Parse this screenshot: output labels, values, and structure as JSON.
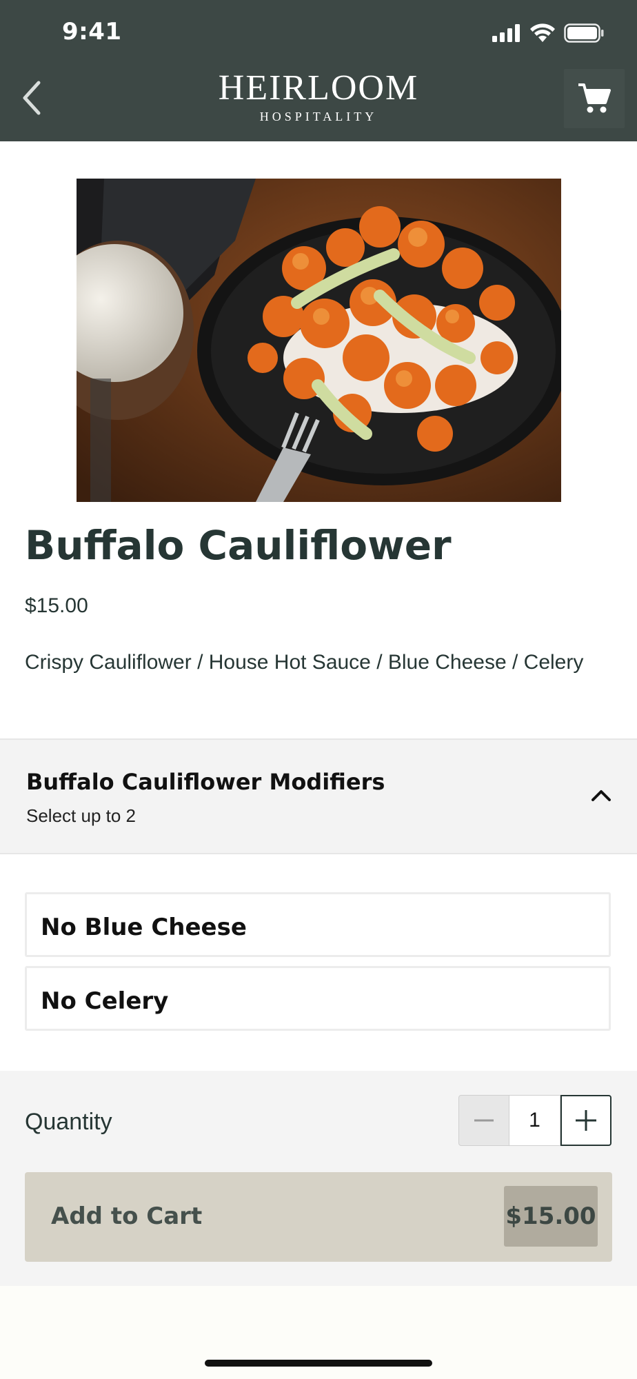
{
  "status_bar": {
    "time": "9:41"
  },
  "header": {
    "logo_main": "HEIRLOOM",
    "logo_sub": "HOSPITALITY",
    "back_icon": "chevron-left-icon",
    "cart_icon": "shopping-cart-icon"
  },
  "item": {
    "title": "Buffalo Cauliflower",
    "price": "$15.00",
    "description": "Crispy Cauliflower / House Hot Sauce / Blue Cheese / Celery"
  },
  "modifiers": {
    "title": "Buffalo Cauliflower Modifiers",
    "subtitle": "Select up to 2",
    "expanded": true,
    "options": [
      {
        "label": "No Blue Cheese"
      },
      {
        "label": "No Celery"
      }
    ]
  },
  "quantity": {
    "label": "Quantity",
    "value": "1"
  },
  "add_to_cart": {
    "label": "Add to Cart",
    "price": "$15.00"
  },
  "colors": {
    "header_bg": "#3d4845",
    "text_primary": "#263634",
    "button_bg": "#d6d2c6",
    "button_price_bg": "#b0ab9e"
  }
}
